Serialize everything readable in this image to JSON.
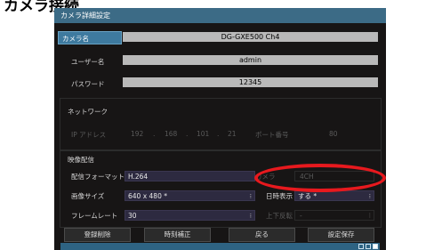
{
  "page_header": "カメラ接続",
  "window": {
    "title": "カメラ詳細設定"
  },
  "camera_name": {
    "label": "カメラ名",
    "value": "DG-GXE500 Ch4"
  },
  "username": {
    "label": "ユーザー名",
    "value": "admin"
  },
  "password": {
    "label": "パスワード",
    "value": "12345"
  },
  "network": {
    "section_label": "ネットワーク",
    "ip_label": "IP アドレス",
    "ip": [
      "192",
      "168",
      "101",
      "21"
    ],
    "port_label": "ポート番号",
    "port": "80"
  },
  "video": {
    "section_label": "映像配信",
    "format_label": "配信フォーマット",
    "format_value": "H.264",
    "camera_label": "カメラ",
    "camera_value": "4CH",
    "size_label": "画像サイズ",
    "size_value": "640 x 480 *",
    "datetime_label": "日時表示",
    "datetime_value": "する *",
    "framerate_label": "フレームレート",
    "framerate_value": "30",
    "flip_label": "上下反転",
    "flip_value": "-"
  },
  "buttons": {
    "delete": "登録削除",
    "time_correct": "時刻補正",
    "back": "戻る",
    "save": "設定保存"
  },
  "colors": {
    "accent": "#3c6b86",
    "highlight": "#e7191e",
    "background": "#171515"
  }
}
